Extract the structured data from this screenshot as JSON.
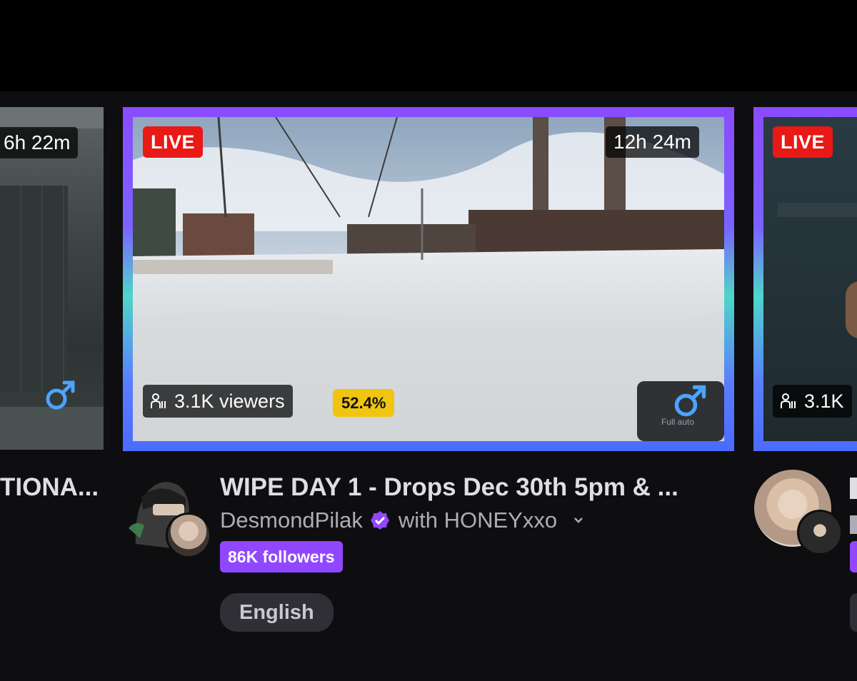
{
  "cards": [
    {
      "duration": "6h 22m",
      "title": "TIONA..."
    },
    {
      "live_label": "LIVE",
      "duration": "12h 24m",
      "viewers": "3.1K viewers",
      "percent": "52.4%",
      "title": "WIPE DAY 1 - Drops Dec 30th 5pm & ...",
      "channel": "DesmondPilak",
      "with_text": "with HONEYxxo",
      "followers": "86K followers",
      "tag": "English",
      "overlay_text": "Full auto"
    },
    {
      "live_label": "LIVE",
      "viewers": "3.1K"
    }
  ],
  "colors": {
    "live": "#e91916",
    "accent": "#9147ff",
    "percent": "#f1c40f",
    "gender_icon": "#4da3ff"
  },
  "icons": {
    "viewer": "person-icon",
    "gender": "male-symbol-icon",
    "verified": "verified-badge-icon",
    "dropdown": "chevron-down-icon"
  }
}
